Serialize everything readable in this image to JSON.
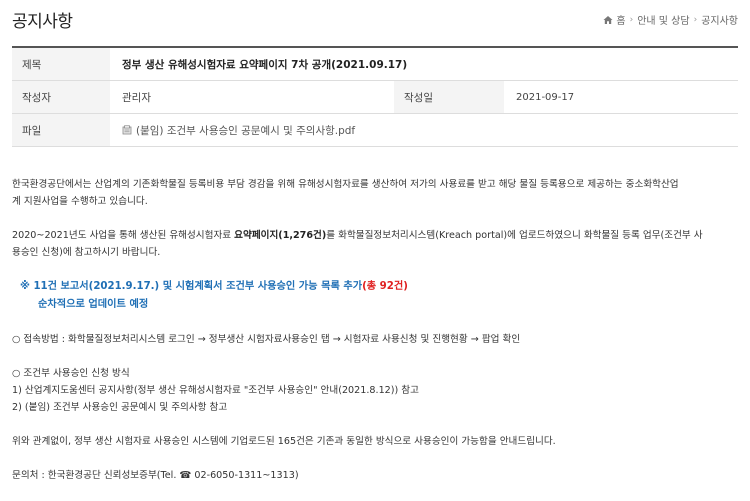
{
  "header": {
    "title": "공지사항",
    "breadcrumb": [
      "홈",
      "안내 및 상담",
      "공지사항"
    ]
  },
  "info": {
    "subject_label": "제목",
    "subject_value": "정부 생산 유해성시험자료 요약페이지 7차 공개(2021.09.17)",
    "author_label": "작성자",
    "author_value": "관리자",
    "date_label": "작성일",
    "date_value": "2021-09-17",
    "file_label": "파일",
    "file_value": "(붙임) 조건부 사용승인 공문예시 및 주의사항.pdf"
  },
  "body": {
    "p1_line1": "한국환경공단에서는 산업계의 기존화학물질 등록비용 부담 경감을 위해 유해성시험자료를 생산하여 저가의 사용료를 받고 해당 물질 등록용으로 제공하는 중소화학산업",
    "p1_line2": "계 지원사업을 수행하고 있습니다.",
    "p2_line1_a": "2020~2021년도 사업을 통해 생산된 유해성시험자료 ",
    "p2_line1_b": "요약페이지(1,276건)",
    "p2_line1_c": "를 화학물질정보처리시스템(Kreach portal)에 업로드하였으니 화학물질 등록 업무(조건부 사",
    "p2_line2": "용승인 신청)에 참고하시기 바랍니다.",
    "notice_a": "※ 11건 보고서(2021.9.17.) 및 시험계획서 조건부 사용승인 가능 목록 추가",
    "notice_b": "(총 92건)",
    "notice_line2": "순차적으로 업데이트 예정",
    "access": "○ 접속방법 : 화학물질정보처리시스템 로그인 → 정부생산 시험자료사용승인 탭 → 시험자료 사용신청 및 진행현황 → 팝업 확인",
    "method_title": "○ 조건부 사용승인 신청 방식",
    "method_1": "1) 산업계지도움센터 공지사항(정부 생산 유해성시험자료 \"조건부 사용승인\" 안내(2021.8.12)) 참고",
    "method_2": "2) (붙임) 조건부 사용승인 공문예시 및 주의사항 참고",
    "regardless": "위와 관계없이, 정부 생산 시험자료 사용승인 시스템에 기업로드된 165건은 기존과 동일한 방식으로 사용승인이 가능함을 안내드립니다.",
    "contact": "문의처 : 한국환경공단 신뢰성보증부(Tel. ☎ 02-6050-1311~1313)"
  },
  "colors": {
    "notice_blue": "#1f6fb5",
    "notice_red": "#e02020",
    "header_border": "#555555"
  },
  "icons": {
    "home": "home-icon",
    "file": "file-icon"
  }
}
